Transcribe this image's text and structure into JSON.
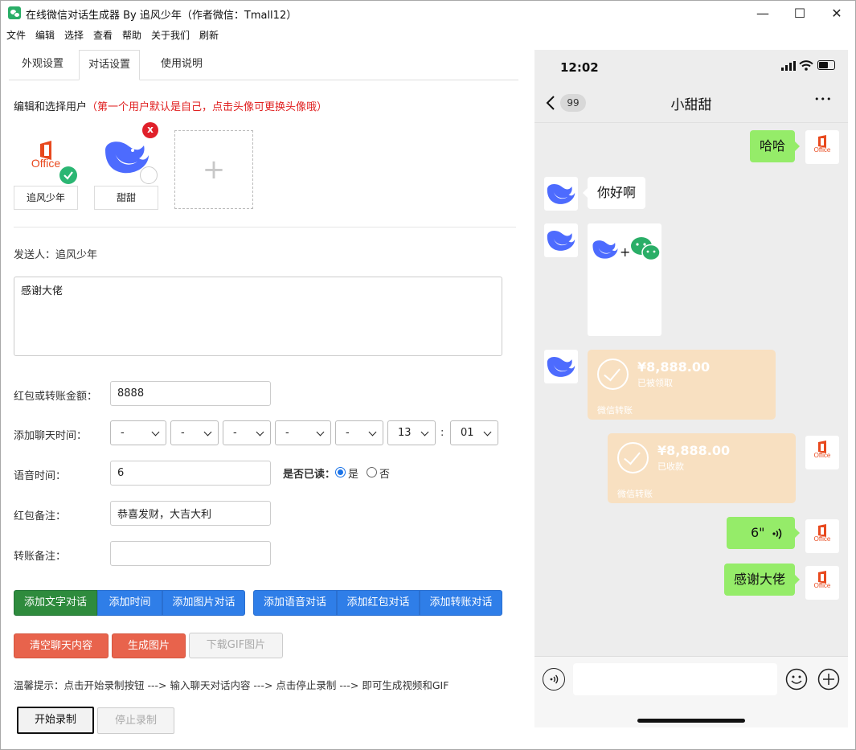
{
  "window": {
    "title": "在线微信对话生成器 By 追风少年（作者微信：Tmall12）",
    "minimize_glyph": "—",
    "maximize_glyph": "☐",
    "close_glyph": "✕"
  },
  "menu": [
    "文件",
    "编辑",
    "选择",
    "查看",
    "帮助",
    "关于我们",
    "刷新"
  ],
  "tabs": [
    {
      "label": "外观设置",
      "active": false
    },
    {
      "label": "对话设置",
      "active": true
    },
    {
      "label": "使用说明",
      "active": false
    }
  ],
  "editor": {
    "section_title": "编辑和选择用户",
    "section_hint": "（第一个用户默认是自己，点击头像可更换头像哦）",
    "users": [
      {
        "name": "追风少年",
        "avatar": "office-logo",
        "avatar_text": "Office",
        "selected": true
      },
      {
        "name": "甜甜",
        "avatar": "deepseek-whale",
        "selected": false,
        "removable": true
      }
    ],
    "add_user_glyph": "+",
    "remove_glyph": "x",
    "sender_label": "发送人：",
    "sender_name": "追风少年",
    "message_text": "感谢大佬",
    "amount_label": "红包或转账金额：",
    "amount_value": "8888",
    "time_label": "添加聊天时间：",
    "time_selects": [
      "-",
      "-",
      "-",
      "-",
      "-",
      "13",
      "01"
    ],
    "time_separator": ":",
    "voice_label": "语音时间：",
    "voice_value": "6",
    "read_label": "是否已读：",
    "read_yes": "是",
    "read_no": "否",
    "read_selected": "是",
    "redpacket_label": "红包备注：",
    "redpacket_value": "恭喜发财，大吉大利",
    "transfer_label": "转账备注：",
    "transfer_value": ""
  },
  "buttons": {
    "add_text": "添加文字对话",
    "add_time": "添加时间",
    "add_image": "添加图片对话",
    "add_voice": "添加语音对话",
    "add_redpacket": "添加红包对话",
    "add_transfer": "添加转账对话",
    "clear": "清空聊天内容",
    "generate": "生成图片",
    "download_gif": "下载GIF图片",
    "start_record": "开始录制",
    "stop_record": "停止录制"
  },
  "tip": "温馨提示：点击开始录制按钮 ---> 输入聊天对话内容 ---> 点击停止录制 ---> 即可生成视频和GIF",
  "phone": {
    "time": "12:02",
    "unread": "99",
    "contact": "小甜甜",
    "more_glyph": "•••",
    "messages": [
      {
        "side": "me",
        "type": "text",
        "text": "哈哈"
      },
      {
        "side": "other",
        "type": "text",
        "text": "你好啊"
      },
      {
        "side": "other",
        "type": "image",
        "plus": "+"
      },
      {
        "side": "other",
        "type": "transfer",
        "amount": "¥8,888.00",
        "status": "已被领取",
        "footer": "微信转账"
      },
      {
        "side": "me",
        "type": "transfer",
        "amount": "¥8,888.00",
        "status": "已收款",
        "footer": "微信转账"
      },
      {
        "side": "me",
        "type": "voice",
        "text": "6\""
      },
      {
        "side": "me",
        "type": "text",
        "text": "感谢大佬"
      }
    ],
    "avatar_text": "Office"
  },
  "colors": {
    "accent_green": "#2e8b3d",
    "accent_blue": "#2f7ee8",
    "accent_red": "#e8634c",
    "bubble_green": "#95ec69",
    "transfer_orange": "#f8e0c1",
    "hint_red": "#e02020"
  }
}
